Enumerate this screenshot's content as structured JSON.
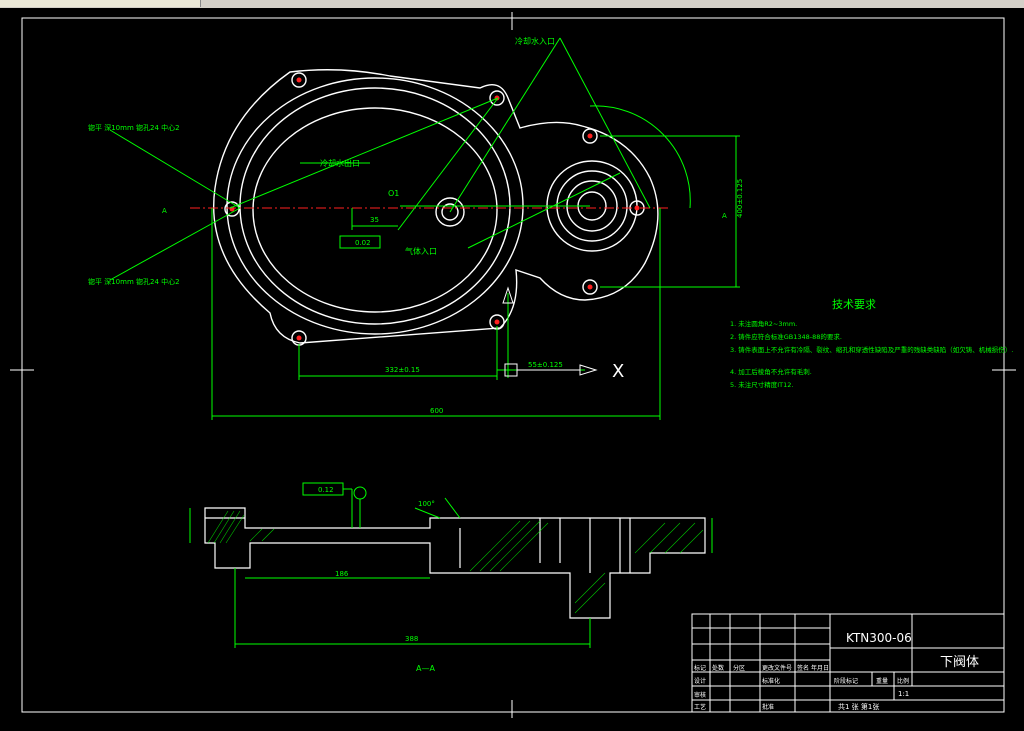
{
  "colors": {
    "background": "#000000",
    "outline": "#ffffff",
    "dimension": "#00ff00",
    "center_line": "#ff0000",
    "frame": "#ffffff",
    "toolbar": "#d4d0c8"
  },
  "title_block": {
    "drawing_number": "KTN300-06",
    "part_name": "下阀体",
    "scale": "1:1",
    "sheet": "共1 张 第1张",
    "rows": [
      "标记",
      "处数",
      "分区",
      "更改文件号",
      "签名",
      "年月日",
      "设计",
      "标准化",
      "审核",
      "工艺",
      "批准",
      "阶段标记",
      "重量",
      "比例"
    ]
  },
  "tech_requirements": {
    "title": "技术要求",
    "items": [
      "1. 未注圆角R2~3mm.",
      "2. 铸件应符合标准GB1348-88的要求.",
      "3. 铸件表面上不允许有冷隔、裂纹、缩孔和穿透性缺陷及严重的残缺类缺陷（如欠铸、机械损伤）.",
      "4. 加工后棱角不允许有毛刺.",
      "5. 未注尺寸精度IT12."
    ]
  },
  "dimensions": {
    "width_total": "600",
    "bolt_spacing": "332±0.15",
    "center_offset": "55±0.125",
    "small_offset": "35",
    "right_height": "400±0.125",
    "section_length": "186",
    "section_total": "388",
    "tolerance_1": "0.02",
    "tolerance_2": "0.12",
    "angle": "100°"
  },
  "labels": {
    "inlet_top": "冷却水入口",
    "outlet": "冷却水出口",
    "center_inlet": "气体入口",
    "note_upper_left": "锪平 深10mm 锪孔24 中心2",
    "note_lower_left": "锪平 深10mm 锪孔24 中心2",
    "section_name": "A—A",
    "axis_x": "X",
    "mark_a": "A",
    "center_mark": "O1"
  }
}
